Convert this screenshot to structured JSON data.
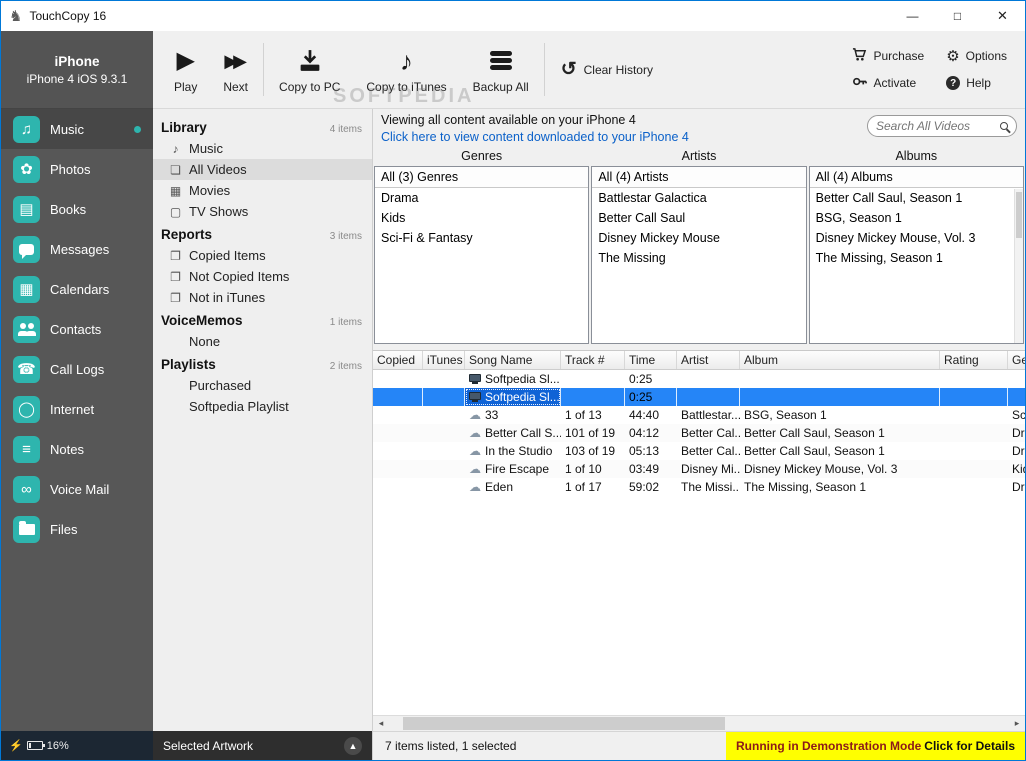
{
  "window": {
    "title": "TouchCopy 16"
  },
  "icons": {
    "app": "♞",
    "minimize": "—",
    "maximize": "□",
    "close": "✕",
    "play": "▶",
    "next": "▶▶",
    "copy_to_itunes": "♪",
    "clear_history": "↺",
    "options_gear": "⚙",
    "help_q": "?",
    "music": "♫",
    "photos": "✿",
    "books": "▤",
    "calendars": "▦",
    "call_logs": "☎",
    "internet": "◯",
    "notes": "≡",
    "voice_mail": "∞",
    "cloud": "☁",
    "battery_bolt": "⚡",
    "artwork_up": "▲",
    "scroll_left": "◂",
    "scroll_right": "▸",
    "lib_music": "♪",
    "lib_videos": "❏",
    "lib_movies": "▦",
    "lib_tv": "▢",
    "lib_report": "❐"
  },
  "device": {
    "name": "iPhone",
    "subtitle": "iPhone 4 iOS 9.3.1"
  },
  "sidebar": {
    "items": [
      {
        "label": "Music"
      },
      {
        "label": "Photos"
      },
      {
        "label": "Books"
      },
      {
        "label": "Messages"
      },
      {
        "label": "Calendars"
      },
      {
        "label": "Contacts"
      },
      {
        "label": "Call Logs"
      },
      {
        "label": "Internet"
      },
      {
        "label": "Notes"
      },
      {
        "label": "Voice Mail"
      },
      {
        "label": "Files"
      }
    ],
    "battery": "16%"
  },
  "toolbar": {
    "play": "Play",
    "next": "Next",
    "copy_to_pc": "Copy to PC",
    "copy_to_itunes": "Copy to iTunes",
    "backup_all": "Backup All",
    "clear_history": "Clear History",
    "purchase": "Purchase",
    "options": "Options",
    "activate": "Activate",
    "help": "Help"
  },
  "library": {
    "sections": [
      {
        "title": "Library",
        "count": "4 items",
        "items": [
          "Music",
          "All Videos",
          "Movies",
          "TV Shows"
        ]
      },
      {
        "title": "Reports",
        "count": "3 items",
        "items": [
          "Copied Items",
          "Not Copied Items",
          "Not in iTunes"
        ]
      },
      {
        "title": "VoiceMemos",
        "count": "1 items",
        "items": [
          "None"
        ]
      },
      {
        "title": "Playlists",
        "count": "2 items",
        "items": [
          "Purchased",
          "Softpedia Playlist"
        ]
      }
    ],
    "footer": "Selected Artwork"
  },
  "main": {
    "viewing": "Viewing all content available on your iPhone 4",
    "link": "Click here to view content downloaded to your iPhone 4",
    "search_placeholder": "Search All Videos"
  },
  "browser": {
    "panes": [
      {
        "header": "Genres",
        "all": "All (3) Genres",
        "items": [
          "Drama",
          "Kids",
          "Sci-Fi & Fantasy"
        ]
      },
      {
        "header": "Artists",
        "all": "All (4) Artists",
        "items": [
          "Battlestar Galactica",
          "Better Call Saul",
          "Disney Mickey Mouse",
          "The Missing"
        ]
      },
      {
        "header": "Albums",
        "all": "All (4) Albums",
        "items": [
          "Better Call Saul, Season 1",
          "BSG, Season 1",
          "Disney Mickey Mouse, Vol. 3",
          "The Missing, Season 1"
        ]
      }
    ]
  },
  "table": {
    "columns": [
      "Copied",
      "iTunes",
      "Song Name",
      "Track #",
      "Time",
      "Artist",
      "Album",
      "Rating",
      "Ge"
    ],
    "rows": [
      {
        "icon": "computer",
        "copied": "",
        "itunes": "",
        "song": "Softpedia Sl...",
        "track": "",
        "time": "0:25",
        "artist": "",
        "album": "",
        "rating": "",
        "genre": ""
      },
      {
        "icon": "computer",
        "copied": "",
        "itunes": "",
        "song": "Softpedia Sl...",
        "track": "",
        "time": "0:25",
        "artist": "",
        "album": "",
        "rating": "",
        "genre": "",
        "selected": true
      },
      {
        "icon": "cloud",
        "copied": "",
        "itunes": "",
        "song": "33",
        "track": "1 of 13",
        "time": "44:40",
        "artist": "Battlestar...",
        "album": "BSG, Season 1",
        "rating": "",
        "genre": "Sci"
      },
      {
        "icon": "cloud",
        "copied": "",
        "itunes": "",
        "song": "Better Call S...",
        "track": "101 of 19",
        "time": "04:12",
        "artist": "Better Cal...",
        "album": "Better Call Saul, Season 1",
        "rating": "",
        "genre": "Dra"
      },
      {
        "icon": "cloud",
        "copied": "",
        "itunes": "",
        "song": "In the Studio",
        "track": "103 of 19",
        "time": "05:13",
        "artist": "Better Cal...",
        "album": "Better Call Saul, Season 1",
        "rating": "",
        "genre": "Dra"
      },
      {
        "icon": "cloud",
        "copied": "",
        "itunes": "",
        "song": "Fire Escape",
        "track": "1 of 10",
        "time": "03:49",
        "artist": "Disney Mi...",
        "album": "Disney Mickey Mouse, Vol. 3",
        "rating": "",
        "genre": "Kid"
      },
      {
        "icon": "cloud",
        "copied": "",
        "itunes": "",
        "song": "Eden",
        "track": "1 of 17",
        "time": "59:02",
        "artist": "The Missi...",
        "album": "The Missing, Season 1",
        "rating": "",
        "genre": "Dra"
      }
    ]
  },
  "status": {
    "items": "7 items listed, 1 selected",
    "demo_mode": "Running in Demonstration Mode",
    "demo_details": "Click for Details"
  },
  "watermark": "SOFTPEDIA",
  "colors": {
    "accent_teal": "#2eb5ae",
    "selection_blue": "#2585f7",
    "demo_yellow": "#ffff00",
    "link_blue": "#0b61c9",
    "window_border": "#0078d7",
    "sidebar_gray": "#575757"
  }
}
